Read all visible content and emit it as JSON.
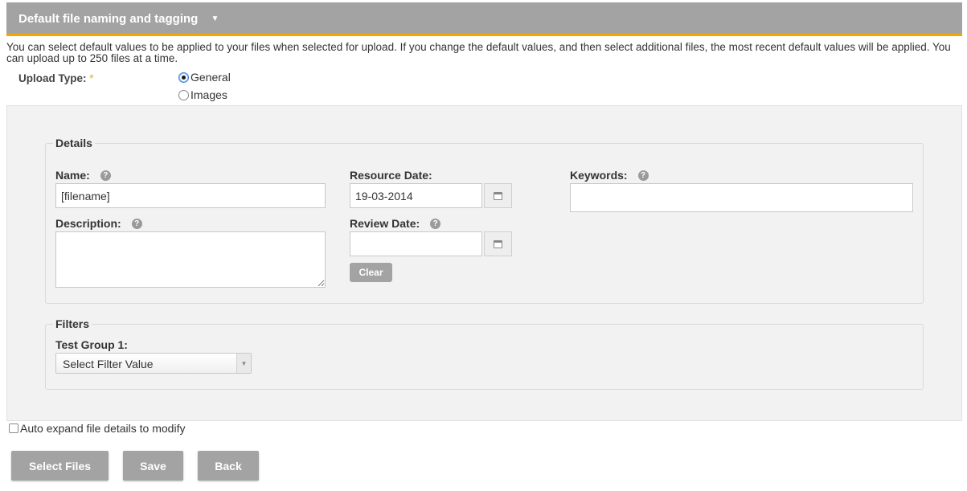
{
  "header": {
    "title": "Default file naming and tagging",
    "caret_icon": "triangle-down-icon"
  },
  "intro_text": "You can select default values to be applied to your files when selected for upload. If you change the default values, and then select additional files, the most recent default values will be applied. You can upload up to 250 files at a time.",
  "upload_type": {
    "label": "Upload Type:",
    "required_mark": "*",
    "options": [
      {
        "label": "General",
        "checked": true
      },
      {
        "label": "Images",
        "checked": false
      }
    ]
  },
  "details": {
    "legend": "Details",
    "name": {
      "label": "Name:",
      "value": "[filename]"
    },
    "description": {
      "label": "Description:",
      "value": ""
    },
    "resource_date": {
      "label": "Resource Date:",
      "value": "19-03-2014"
    },
    "review_date": {
      "label": "Review Date:",
      "value": ""
    },
    "clear_label": "Clear",
    "keywords": {
      "label": "Keywords:",
      "value": ""
    },
    "help_glyph": "?"
  },
  "filters": {
    "legend": "Filters",
    "group_label": "Test Group 1:",
    "select_value": "Select Filter Value"
  },
  "auto_expand_label": "Auto expand file details to modify",
  "buttons": {
    "select_files": "Select Files",
    "save": "Save",
    "back": "Back"
  },
  "colors": {
    "header_bg": "#a3a3a3",
    "accent": "#f0a900",
    "panel_bg": "#f2f2f2",
    "button_bg": "#a3a3a3"
  }
}
